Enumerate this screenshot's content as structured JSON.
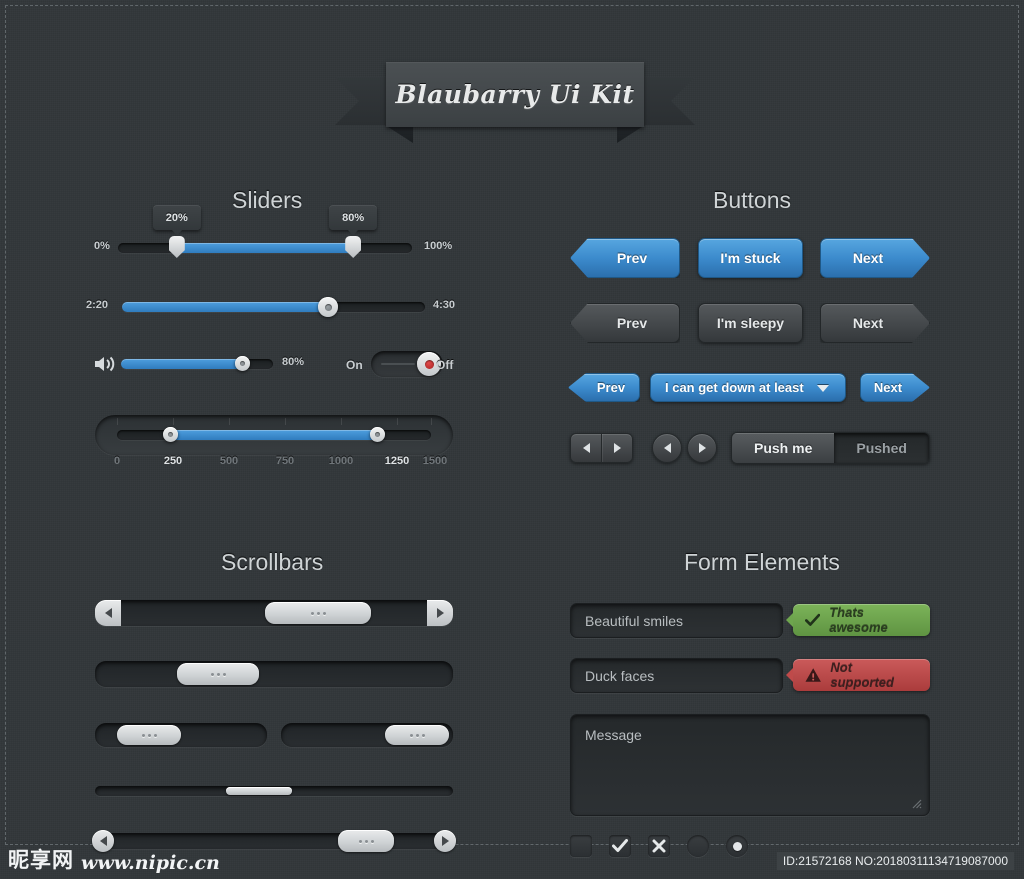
{
  "app": {
    "title": "Blaubarry Ui Kit"
  },
  "colors": {
    "background": "#32373a",
    "accent_blue": "#3c8bcd",
    "success_green": "#6ea54e",
    "error_red": "#bf4a4a",
    "panel_dark": "#25292b",
    "thumb_light": "#cfd3d5"
  },
  "sections": {
    "sliders": {
      "title": "Sliders"
    },
    "buttons": {
      "title": "Buttons"
    },
    "scrollbars": {
      "title": "Scrollbars"
    },
    "form": {
      "title": "Form Elements"
    }
  },
  "sliders": {
    "range_percent": {
      "min_label": "0%",
      "max_label": "100%",
      "low_tooltip": "20%",
      "high_tooltip": "80%",
      "low_value": 20,
      "high_value": 80
    },
    "time": {
      "start_label": "2:20",
      "end_label": "4:30",
      "value": 68
    },
    "volume": {
      "icon": "speaker-icon",
      "value_label": "80%",
      "value": 80
    },
    "toggle": {
      "on_label": "On",
      "off_label": "Off",
      "state": "off"
    },
    "scale": {
      "ticks": [
        "0",
        "250",
        "500",
        "750",
        "1000",
        "1250",
        "1500"
      ],
      "active_ticks": [
        "250",
        "1250"
      ],
      "low_value": 250,
      "high_value": 1250,
      "min": 0,
      "max": 1500
    }
  },
  "buttons": {
    "row1": [
      {
        "label": "Prev",
        "style": "blue",
        "shape": "arrow-left"
      },
      {
        "label": "I'm stuck",
        "style": "blue",
        "shape": "rect"
      },
      {
        "label": "Next",
        "style": "blue",
        "shape": "arrow-right"
      }
    ],
    "row2": [
      {
        "label": "Prev",
        "style": "grey",
        "shape": "arrow-left"
      },
      {
        "label": "I'm sleepy",
        "style": "grey",
        "shape": "rect"
      },
      {
        "label": "Next",
        "style": "grey",
        "shape": "arrow-right"
      }
    ],
    "row3": {
      "prev": "Prev",
      "dropdown": "I can get down at least",
      "next": "Next"
    },
    "row4": {
      "segmented_pressed_label": "Push me",
      "segmented_active_label": "Pushed"
    }
  },
  "scrollbars": {
    "bar1": {
      "thumb_grip": "...",
      "thumb_percent": 46,
      "has_end_caps": true
    },
    "bar2": {
      "thumb_grip": "...",
      "thumb_percent": 22,
      "has_end_caps": false
    },
    "bar3": {
      "thumb_grip": "...",
      "thumb_percent": 17
    },
    "bar4": {
      "thumb_grip": "...",
      "thumb_percent": 80
    },
    "bar5": {
      "thumb_percent": 38,
      "slim": true
    },
    "bar6": {
      "thumb_grip": "...",
      "thumb_percent": 73,
      "has_round_caps": true
    }
  },
  "form": {
    "input_valid": {
      "value": "Beautiful smiles"
    },
    "callout_valid": {
      "text": "Thats awesome",
      "icon": "check-icon",
      "color": "#6ea54e"
    },
    "input_invalid": {
      "value": "Duck faces"
    },
    "callout_invalid": {
      "text": "Not supported",
      "icon": "warning-icon",
      "color": "#bf4a4a"
    },
    "textarea": {
      "placeholder": "Message",
      "value": ""
    },
    "choices": [
      {
        "type": "checkbox",
        "name": "checkbox-empty",
        "state": "unchecked"
      },
      {
        "type": "checkbox",
        "name": "checkbox-checked",
        "state": "checked"
      },
      {
        "type": "checkbox",
        "name": "checkbox-crossed",
        "state": "crossed"
      },
      {
        "type": "radio",
        "name": "radio-empty",
        "state": "unselected"
      },
      {
        "type": "radio",
        "name": "radio-selected",
        "state": "selected"
      }
    ]
  },
  "footer": {
    "watermark_logo": "昵享网",
    "watermark_url": "www.nipic.cn",
    "id_text": "ID:21572168 NO:20180311134719087000"
  }
}
